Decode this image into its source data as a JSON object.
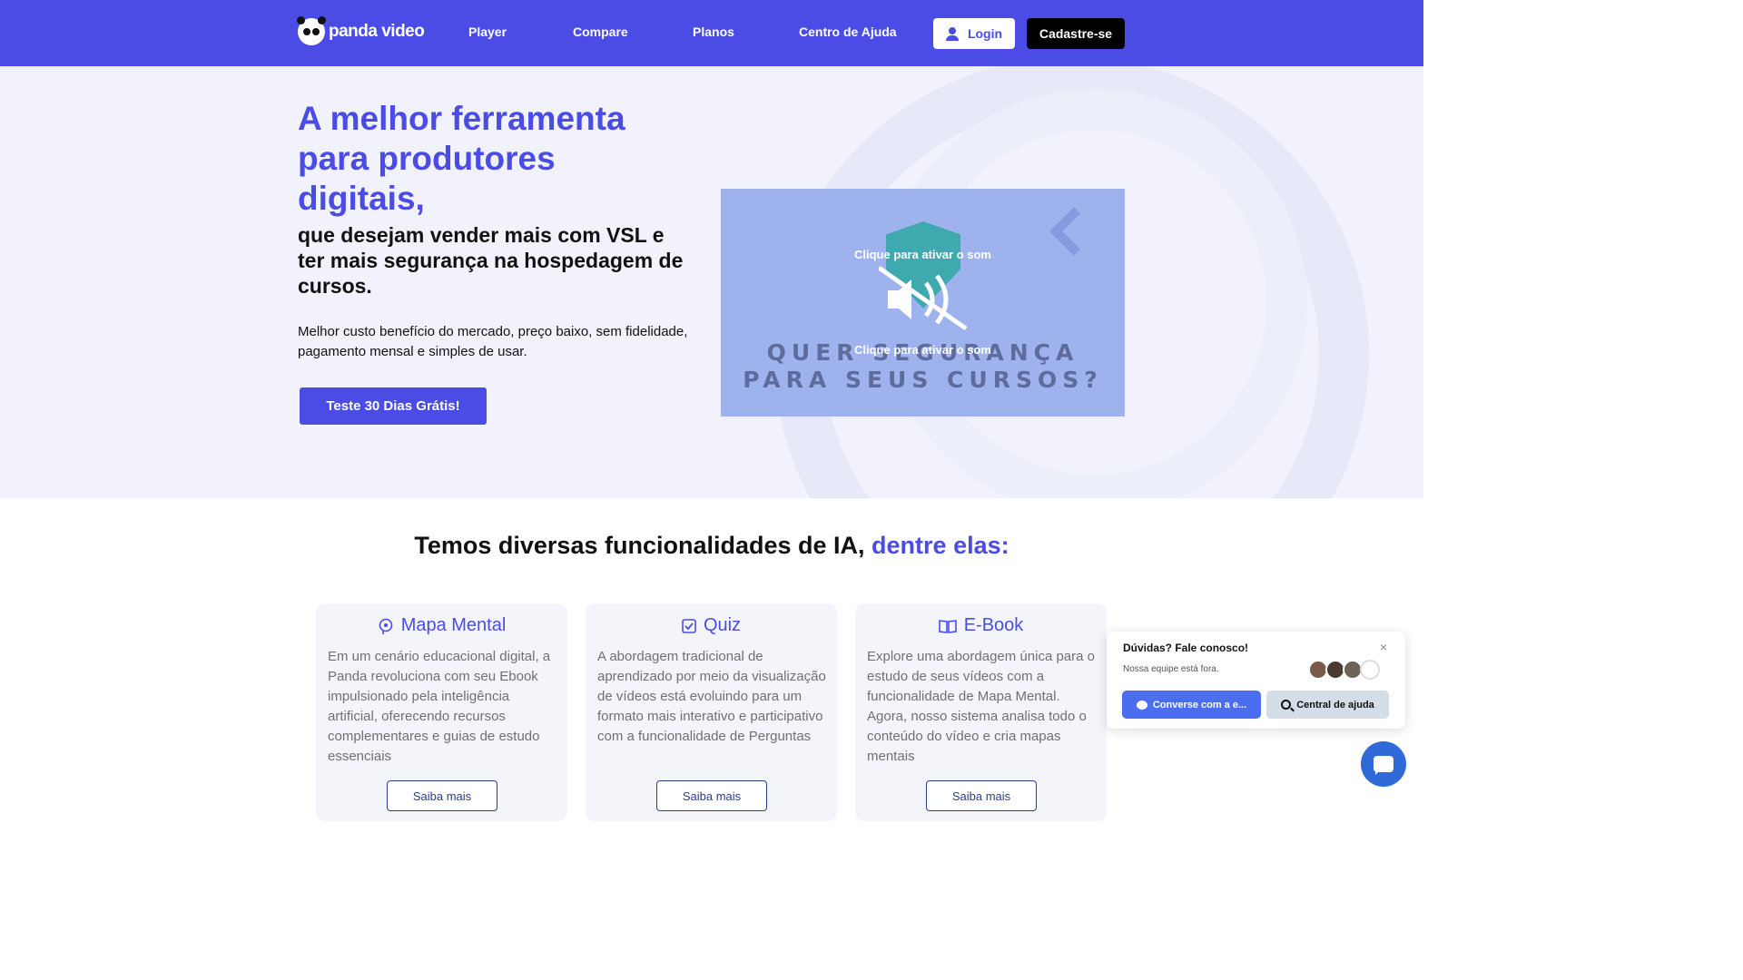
{
  "nav": {
    "logo_text": "panda video",
    "links": [
      "Player",
      "Compare",
      "Planos",
      "Centro de Ajuda"
    ],
    "login_label": "Login",
    "signup_label": "Cadastre-se"
  },
  "hero": {
    "title": "A melhor ferramenta para produtores digitais,",
    "subtitle": "que desejam vender mais com VSL e ter mais segurança na hospedagem de cursos.",
    "description": "Melhor custo benefício do mercado, preço baixo, sem fidelidade, pagamento mensal e simples de usar.",
    "cta_label": "Teste 30 Dias Grátis!"
  },
  "video": {
    "sound_hint": "Clique para ativar o som",
    "headline_line1": "QUER SEGURANÇA",
    "headline_line2": "PARA SEUS CURSOS?"
  },
  "features": {
    "title": "Temos diversas funcionalidades de IA,",
    "title_accent": "dentre elas:",
    "cards": [
      {
        "title": "Mapa Mental",
        "icon": "head-icon",
        "body": "Em um cenário educacional digital, a Panda revoluciona com seu Ebook impulsionado pela inteligência artificial, oferecendo recursos complementares e guias de estudo essenciais",
        "button": "Saiba mais"
      },
      {
        "title": "Quiz",
        "icon": "checkbox-icon",
        "body": "A abordagem tradicional de aprendizado por meio da visualização de vídeos está evoluindo para um formato mais interativo e participativo com a funcionalidade de Perguntas",
        "button": "Saiba mais"
      },
      {
        "title": "E-Book",
        "icon": "book-icon",
        "body": "Explore uma abordagem única para o estudo de seus vídeos com a funcionalidade de Mapa Mental. Agora, nosso sistema analisa todo o conteúdo do vídeo e cria mapas mentais",
        "button": "Saiba mais"
      }
    ]
  },
  "chat": {
    "title": "Dúvidas? Fale conosco!",
    "subtitle": "Nossa equipe está fora.",
    "close": "×",
    "chat_button": "Converse com a e...",
    "help_button": "Central de ajuda"
  },
  "colors": {
    "brand": "#4b4ce6",
    "hero_bg": "#f1f2fb",
    "video_bg": "#9eb2ee",
    "chat_button": "#4b6ef0"
  }
}
